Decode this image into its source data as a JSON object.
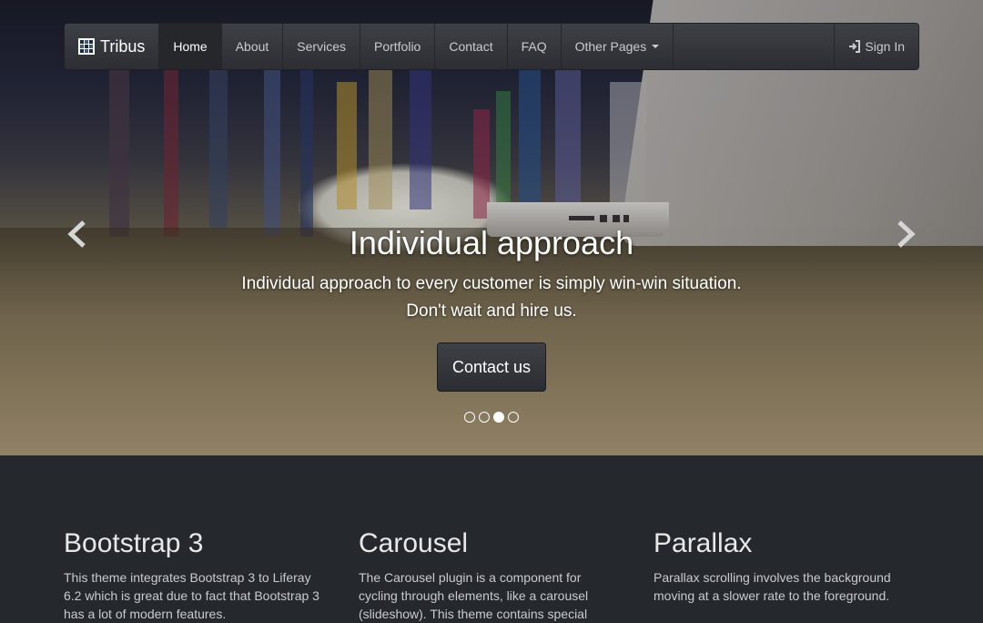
{
  "navbar": {
    "brand": "Tribus",
    "items": [
      {
        "label": "Home",
        "active": true
      },
      {
        "label": "About"
      },
      {
        "label": "Services"
      },
      {
        "label": "Portfolio"
      },
      {
        "label": "Contact"
      },
      {
        "label": "FAQ"
      },
      {
        "label": "Other Pages"
      }
    ],
    "signin": "Sign In"
  },
  "hero": {
    "title": "Individual approach",
    "subtitle_line1": "Individual approach to every customer is simply win-win situation.",
    "subtitle_line2": "Don't wait and hire us.",
    "cta": "Contact us",
    "slide_count": 4,
    "active_slide": 3
  },
  "features": [
    {
      "title": "Bootstrap 3",
      "text": "This theme integrates Bootstrap 3 to Liferay 6.2 which is great due to fact that Bootstrap 3 has a lot of modern features."
    },
    {
      "title": "Carousel",
      "text": "The Carousel plugin is a component for cycling through elements, like a carousel (slideshow). This theme contains special"
    },
    {
      "title": "Parallax",
      "text": "Parallax scrolling involves the background moving at a slower rate to the foreground."
    }
  ],
  "colors": {
    "section_bg": "#25282c",
    "navbar_bg": "#2c2e33"
  }
}
